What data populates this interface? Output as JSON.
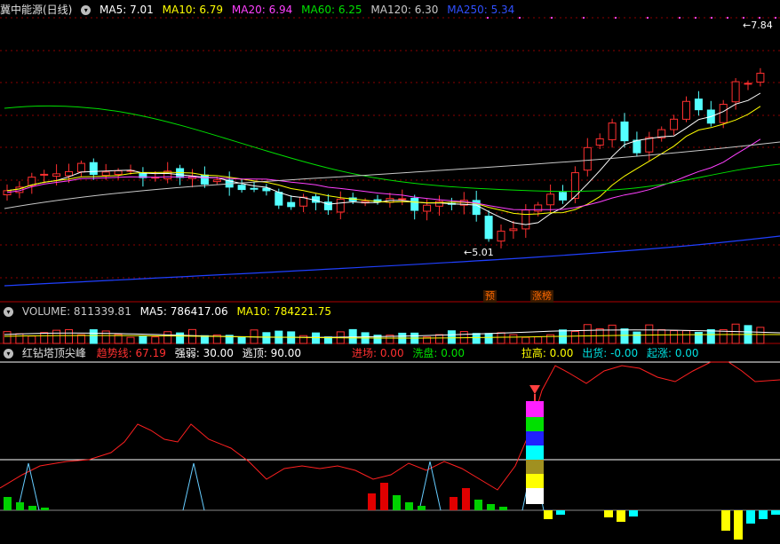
{
  "main": {
    "title": "冀中能源(日线)",
    "ma": [
      {
        "label": "MA5: 7.01",
        "color": "#ffffff"
      },
      {
        "label": "MA10: 6.79",
        "color": "#ffff00"
      },
      {
        "label": "MA20: 6.94",
        "color": "#ff40ff"
      },
      {
        "label": "MA60: 6.25",
        "color": "#00e000"
      },
      {
        "label": "MA120: 6.30",
        "color": "#c8c8c8"
      },
      {
        "label": "MA250: 5.34",
        "color": "#3050ff"
      }
    ],
    "high_label": "7.84",
    "low_label": "5.01",
    "signal_yu": "预",
    "signal_zhangbang": "涨榜"
  },
  "volume": {
    "items": [
      {
        "label": "VOLUME: 811339.81",
        "color": "#c8c8c8"
      },
      {
        "label": "MA5: 786417.06",
        "color": "#ffffff"
      },
      {
        "label": "MA10: 784221.75",
        "color": "#ffff00"
      }
    ]
  },
  "indicator": {
    "title": "红钻塔顶尖峰",
    "items_left": [
      {
        "label": "趋势线: 67.19",
        "color": "#ff3030"
      },
      {
        "label": "强弱: 30.00",
        "color": "#ffffff"
      },
      {
        "label": "逃顶: 90.00",
        "color": "#ffffff"
      }
    ],
    "items_right": [
      {
        "label": "进场: 0.00",
        "color": "#ff3030"
      },
      {
        "label": "洗盘: 0.00",
        "color": "#00e000"
      },
      {
        "label": "拉高: 0.00",
        "color": "#ffff00"
      },
      {
        "label": "出货: -0.00",
        "color": "#00e0e0"
      },
      {
        "label": "起涨: 0.00",
        "color": "#00e0e0"
      }
    ]
  },
  "colors": {
    "up": "#ff3030",
    "down": "#54ffff",
    "grid": "#8b0000"
  }
}
